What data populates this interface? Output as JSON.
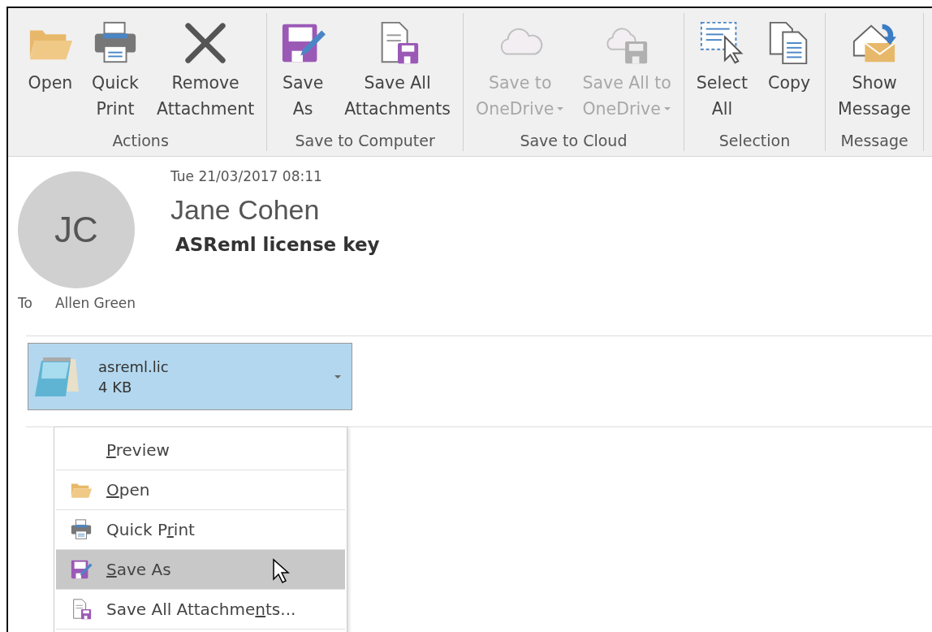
{
  "ribbon": {
    "groups": [
      {
        "label": "Actions",
        "buttons": [
          {
            "label": "Open",
            "disabled": false
          },
          {
            "label": "Quick\nPrint",
            "disabled": false
          },
          {
            "label": "Remove\nAttachment",
            "disabled": false
          }
        ]
      },
      {
        "label": "Save to Computer",
        "buttons": [
          {
            "label": "Save\nAs",
            "disabled": false
          },
          {
            "label": "Save All\nAttachments",
            "disabled": false
          }
        ]
      },
      {
        "label": "Save to Cloud",
        "buttons": [
          {
            "label": "Save to\nOneDrive",
            "disabled": true,
            "dropdown": true
          },
          {
            "label": "Save All to\nOneDrive",
            "disabled": true,
            "dropdown": true
          }
        ]
      },
      {
        "label": "Selection",
        "buttons": [
          {
            "label": "Select\nAll",
            "disabled": false
          },
          {
            "label": "Copy",
            "disabled": false
          }
        ]
      },
      {
        "label": "Message",
        "buttons": [
          {
            "label": "Show\nMessage",
            "disabled": false
          }
        ]
      }
    ]
  },
  "message": {
    "avatar_initials": "JC",
    "date": "Tue 21/03/2017 08:11",
    "sender": "Jane Cohen",
    "subject": "ASReml license key",
    "to_label": "To",
    "to": "Allen Green"
  },
  "attachment": {
    "name": "asreml.lic",
    "size": "4 KB",
    "selected": true
  },
  "context_menu": {
    "items": [
      {
        "key": "P",
        "after": "review",
        "selected": false
      },
      {
        "key": "O",
        "after": "pen",
        "selected": false
      },
      {
        "before": "Quick P",
        "key": "r",
        "after": "int",
        "selected": false
      },
      {
        "key": "S",
        "after": "ave As",
        "selected": true
      },
      {
        "before": "Save All Attachme",
        "key": "n",
        "after": "ts...",
        "selected": false
      }
    ]
  }
}
